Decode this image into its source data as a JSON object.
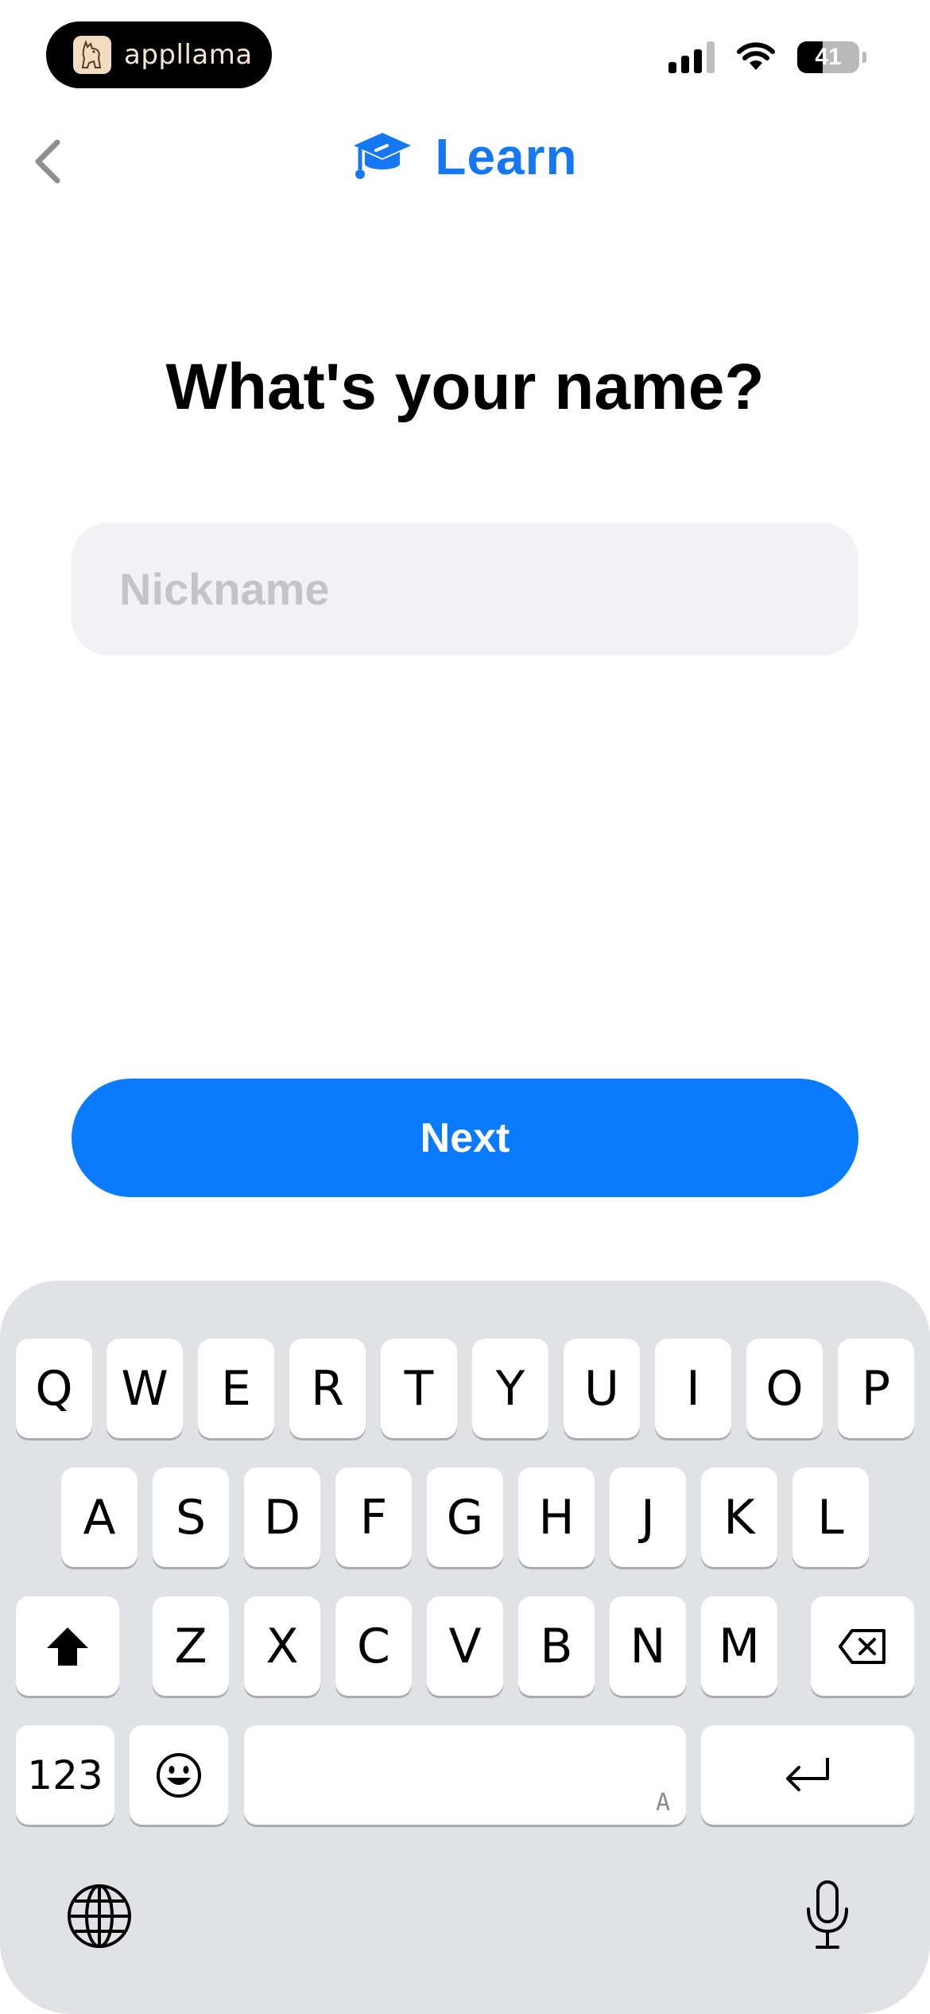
{
  "status_bar": {
    "overlay_brand": "appllama",
    "battery_level": "41",
    "battery_percent": 41
  },
  "header": {
    "app_title": "Learn",
    "accent_color": "#1677f2"
  },
  "form": {
    "question": "What's your name?",
    "nickname_placeholder": "Nickname",
    "nickname_value": "",
    "next_label": "Next"
  },
  "keyboard": {
    "row1": [
      "Q",
      "W",
      "E",
      "R",
      "T",
      "Y",
      "U",
      "I",
      "O",
      "P"
    ],
    "row2": [
      "A",
      "S",
      "D",
      "F",
      "G",
      "H",
      "J",
      "K",
      "L"
    ],
    "row3": [
      "Z",
      "X",
      "C",
      "V",
      "B",
      "N",
      "M"
    ],
    "numbers_label": "123",
    "space_hint": "A",
    "icons": [
      "shift-icon",
      "delete-icon",
      "emoji-icon",
      "return-icon",
      "globe-icon",
      "microphone-icon"
    ]
  }
}
